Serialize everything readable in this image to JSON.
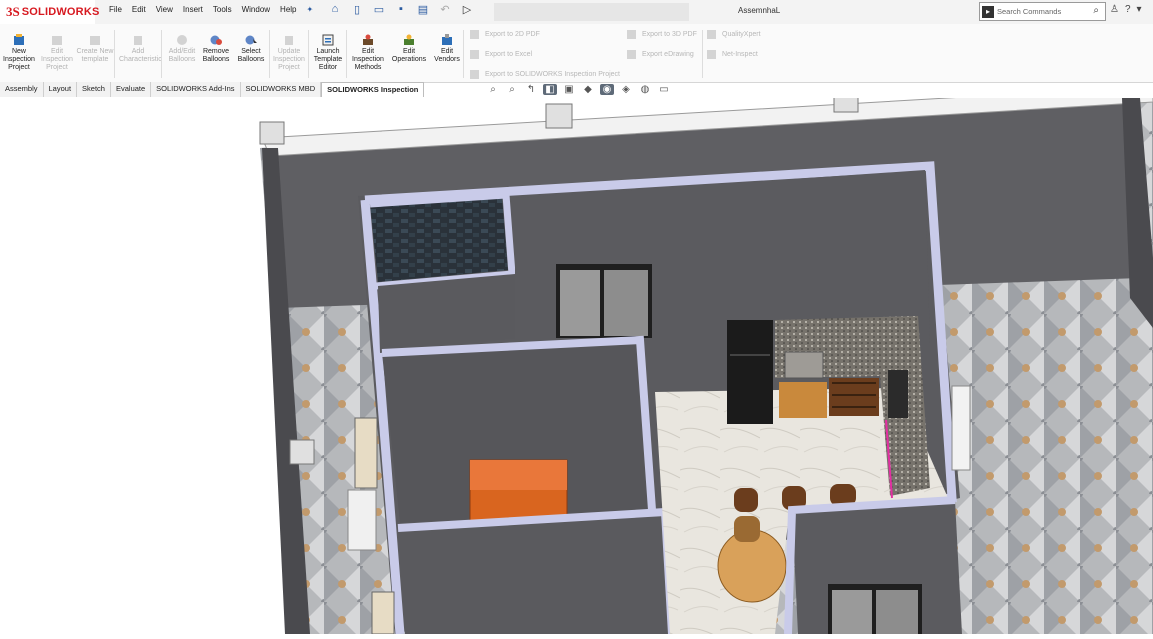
{
  "app": {
    "brand_ds": "3S",
    "brand_name": "SOLIDWORKS",
    "doc_title": "AssemnhaL"
  },
  "menu": [
    "File",
    "Edit",
    "View",
    "Insert",
    "Tools",
    "Window",
    "Help"
  ],
  "search": {
    "placeholder": "Search Commands"
  },
  "ribbon": {
    "buttons": [
      {
        "label": "New Inspection Project",
        "enabled": true
      },
      {
        "label": "Edit Inspection Project",
        "enabled": false
      },
      {
        "label": "Create New template",
        "enabled": false
      },
      {
        "label": "Add Characteristic",
        "enabled": false
      },
      {
        "label": "Add/Edit Balloons",
        "enabled": false
      },
      {
        "label": "Remove Balloons",
        "enabled": true
      },
      {
        "label": "Select Balloons",
        "enabled": true
      },
      {
        "label": "Update Inspection Project",
        "enabled": false
      },
      {
        "label": "Launch Template Editor",
        "enabled": true
      },
      {
        "label": "Edit Inspection Methods",
        "enabled": true
      },
      {
        "label": "Edit Operations",
        "enabled": true
      },
      {
        "label": "Edit Vendors",
        "enabled": true
      }
    ],
    "export_list_1": [
      "Export to 2D PDF",
      "Export to Excel",
      "Export to SOLIDWORKS Inspection Project"
    ],
    "export_list_2": [
      "Export to 3D PDF",
      "Export eDrawing"
    ],
    "export_list_3": [
      "QualityXpert",
      "Net-Inspect"
    ]
  },
  "tabs": [
    "Assembly",
    "Layout",
    "Sketch",
    "Evaluate",
    "SOLIDWORKS Add-Ins",
    "SOLIDWORKS MBD",
    "SOLIDWORKS Inspection"
  ],
  "active_tab": "SOLIDWORKS Inspection",
  "colors": {
    "brand": "#d71920",
    "wall": "#5f5f63",
    "wall_top": "#c9cbe9",
    "table": "#d9651f"
  }
}
